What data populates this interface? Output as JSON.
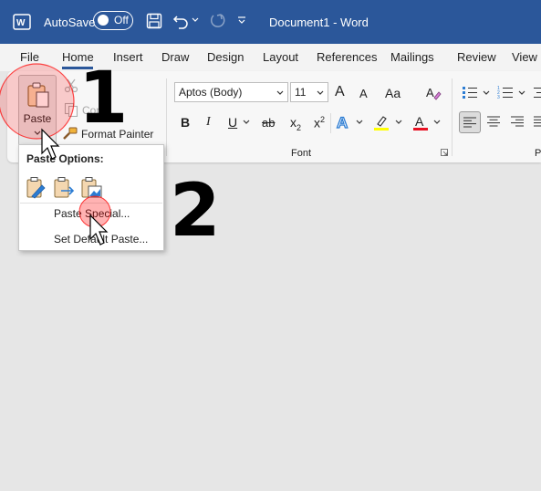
{
  "titlebar": {
    "autosave_label": "AutoSave",
    "autosave_state": "Off",
    "document_title": "Document1  -  Word",
    "brand_color": "#2b579a"
  },
  "tabs": [
    "File",
    "Home",
    "Insert",
    "Draw",
    "Design",
    "Layout",
    "References",
    "Mailings",
    "Review",
    "View"
  ],
  "active_tab": "Home",
  "clipboard": {
    "paste_label": "Paste",
    "copy_label": "Copy",
    "format_painter_label": "Format Painter"
  },
  "font": {
    "font_name": "Aptos (Body)",
    "font_size": "11",
    "group_label": "Font",
    "grow_glyph": "A",
    "shrink_glyph": "A",
    "case_glyph": "Aa",
    "bold": "B",
    "italic": "I",
    "underline": "U",
    "strike": "ab",
    "subscript": "x",
    "subscript_mark": "2",
    "superscript": "x",
    "superscript_mark": "2",
    "highlight_color": "#ffff00",
    "font_color": "#e81123"
  },
  "paragraph_group_label_partial": "P",
  "paste_menu": {
    "header": "Paste Options:",
    "options": [
      "keep-source-formatting-icon",
      "merge-formatting-icon",
      "picture-icon"
    ],
    "items": [
      "Paste Special...",
      "Set Default Paste..."
    ]
  },
  "annotations": {
    "step1": "1",
    "step2": "2",
    "highlight_color": "#ff0000"
  }
}
